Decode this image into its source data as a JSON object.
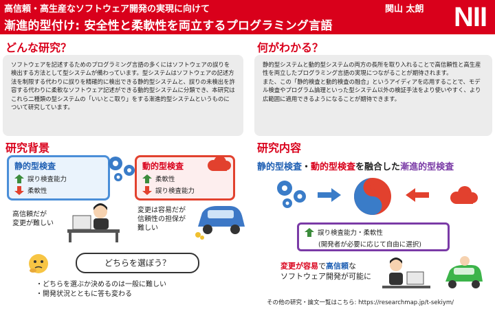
{
  "header": {
    "subtitle": "高信頼・高生産なソフトウェア開発の実現に向けて",
    "author": "関山 太朗",
    "title": "漸進的型付け: 安全性と柔軟性を両立するプログラミング言語",
    "logo": "NII"
  },
  "research": {
    "heading": "どんな研究？",
    "body": "ソフトウェアを記述するためのプログラミング言語の多くにはソフトウェアの誤りを検出する方法として型システムが備わっています。型システムはソフトウェアの記述方法を制限する代わりに誤りを精確的に検出できる静的型システムと、誤りの未検出を許容する代わりに柔軟なソフトウェア記述ができる動的型システムに分類でき、本研究はこれら二種類の型システムの「いいとこ取り」をする漸進的型システムというものについて研究しています。"
  },
  "findings": {
    "heading": "何がわかる？",
    "body1": "静的型システムと動的型システムの両方の長所を取り入れることで高信頼性と高生産性を両立したプログラミング言語の実現につながることが期待されます。",
    "body2": "また、この「静的検査と動的検査の融合」というアイディアを応用することで、モデル検査やプログラム論理といった型システム以外の検証手法をより使いやすく、より広範囲に適用できるようになることが期待できます。"
  },
  "background": {
    "heading": "研究背景",
    "static": {
      "title": "静的型検査",
      "up": "誤り検査能力",
      "down": "柔軟性"
    },
    "dynamic": {
      "title": "動的型検査",
      "up": "柔軟性",
      "down": "誤り検査能力"
    },
    "static_note": "高信頼だが\n変更が難しい",
    "dynamic_note": "変更は容易だが\n信頼性の担保が\n難しい",
    "question": "どちらを選ぼう？",
    "bullets": [
      "どちらを選ぶか決めるのは一般に難しい",
      "開発状況とともに答も変わる"
    ]
  },
  "content": {
    "heading": "研究内容",
    "fusion_a": "静的型検査",
    "fusion_sep": "・",
    "fusion_b": "動的型検査",
    "fusion_mid": "を融合した",
    "fusion_c": "漸進的型検査",
    "merged_line1": "誤り検査能力・柔軟性",
    "merged_line2": "(開発者が必要に応じて自由に選択)",
    "result_a": "変更が容易",
    "result_b": "で",
    "result_c": "高信頼",
    "result_d": "な",
    "result_e": "ソフトウェア開発が可能に"
  },
  "footer": "その他の研究・論文一覧はこちら: https://researchmap.jp/t-sekiym/",
  "colors": {
    "header": "#d9001b",
    "static": "#4a8ed8",
    "dynamic": "#e2412e",
    "gradual": "#7a3aa6"
  }
}
